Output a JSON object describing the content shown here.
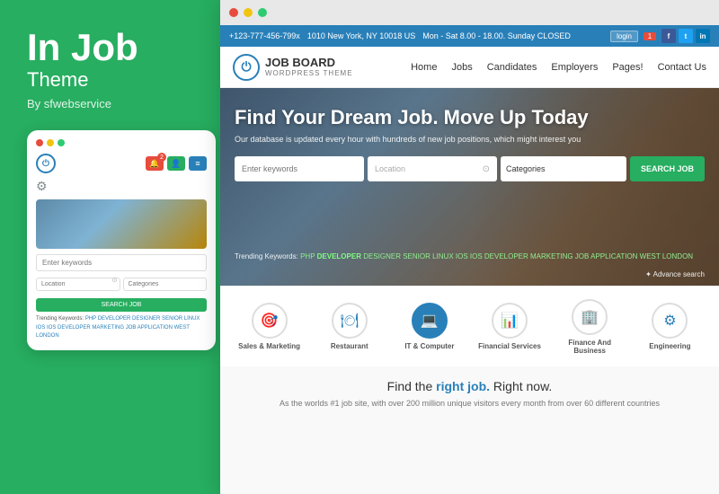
{
  "left": {
    "brand_title": "In Job",
    "brand_subtitle": "Theme",
    "brand_by": "By sfwebservice",
    "mini_dots": [
      "red",
      "yellow",
      "green"
    ],
    "mini_logo_text": "⏻",
    "mini_search_placeholder": "Enter keywords",
    "mini_location_placeholder": "Location",
    "mini_categories_placeholder": "Categories",
    "mini_search_btn": "SEARCH JOB",
    "mini_trending_label": "Trending Keywords:",
    "mini_trending_keywords": [
      "PHP",
      "DEVELOPER",
      "DESIGNER",
      "SENIOR",
      "LINUX",
      "IOS",
      "IOS DEVELOPER",
      "MARKETING",
      "JOB APPLICATION",
      "WEST LONDON"
    ]
  },
  "browser": {
    "topbar": {
      "phone": "+123-777-456-799x",
      "address": "1010 New York, NY 10018 US",
      "hours": "Mon - Sat 8.00 - 18.00. Sunday CLOSED",
      "login_label": "login",
      "notification_count": "1"
    },
    "nav": {
      "logo_text": "JOB BOARD",
      "logo_sub": "WORDPRESS THEME",
      "links": [
        "Home",
        "Jobs",
        "Candidates",
        "Employers",
        "Pages!",
        "Contact Us"
      ]
    },
    "hero": {
      "title": "Find Your Dream Job. Move Up Today",
      "subtitle": "Our database is updated every hour with hundreds of new job positions, which might interest you",
      "search_placeholder": "Enter keywords",
      "location_placeholder": "Location",
      "categories_placeholder": "Categories",
      "search_btn": "SEARCH JOB",
      "trending_label": "Trending Keywords:",
      "trending_keywords": [
        "PHP",
        "DEVELOPER",
        "DESIGNER",
        "SENIOR",
        "LINUX",
        "IOS",
        "IOS DEVELOPER",
        "MARKETING",
        "JOB APPLICATION",
        "WEST LONDON"
      ],
      "advance_search": "Advance search"
    },
    "categories": [
      {
        "label": "Sales & Marketing",
        "icon": "🎯"
      },
      {
        "label": "Restaurant",
        "icon": "🍽"
      },
      {
        "label": "IT & Computer",
        "icon": "💻",
        "active": true
      },
      {
        "label": "Financial Services",
        "icon": "📊"
      },
      {
        "label": "Finance And Business",
        "icon": "🏢"
      },
      {
        "label": "Engineering",
        "icon": "⚙"
      }
    ],
    "bottom": {
      "title_start": "Find the ",
      "title_bold": "right job.",
      "title_end": " Right now.",
      "desc": "As the worlds #1 job site, with over 200 million unique visitors every month from over 60 different countries"
    }
  }
}
